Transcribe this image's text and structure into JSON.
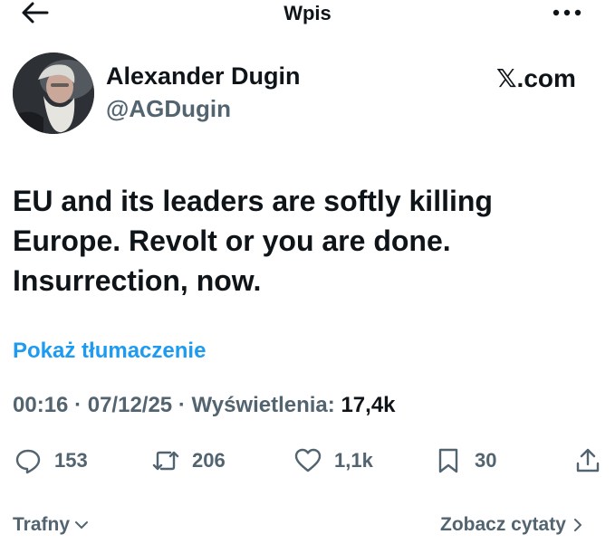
{
  "header": {
    "title": "Wpis"
  },
  "author": {
    "name": "Alexander Dugin",
    "handle": "@AGDugin",
    "source": "𝕏.com"
  },
  "post": {
    "lines": [
      "EU and its leaders are softly killing",
      "Europe. Revolt or you are done.",
      "Insurrection, now."
    ],
    "translate_label": "Pokaż tłumaczenie",
    "time": "00:16",
    "date": "07/12/25",
    "views_label": "Wyświetlenia:",
    "views_count": "17,4k",
    "separator": "·"
  },
  "actions": {
    "replies": "153",
    "reposts": "206",
    "likes": "1,1k",
    "bookmarks": "30"
  },
  "footer": {
    "sort_label": "Trafny",
    "quotes_label": "Zobacz cytaty"
  },
  "icons": {
    "back": "back-arrow-icon",
    "more": "more-icon",
    "reply": "reply-icon",
    "repost": "repost-icon",
    "like": "heart-icon",
    "bookmark": "bookmark-icon",
    "share": "share-icon"
  },
  "colors": {
    "link": "#1d9bf0",
    "secondary": "#536471",
    "text": "#0f1419"
  }
}
